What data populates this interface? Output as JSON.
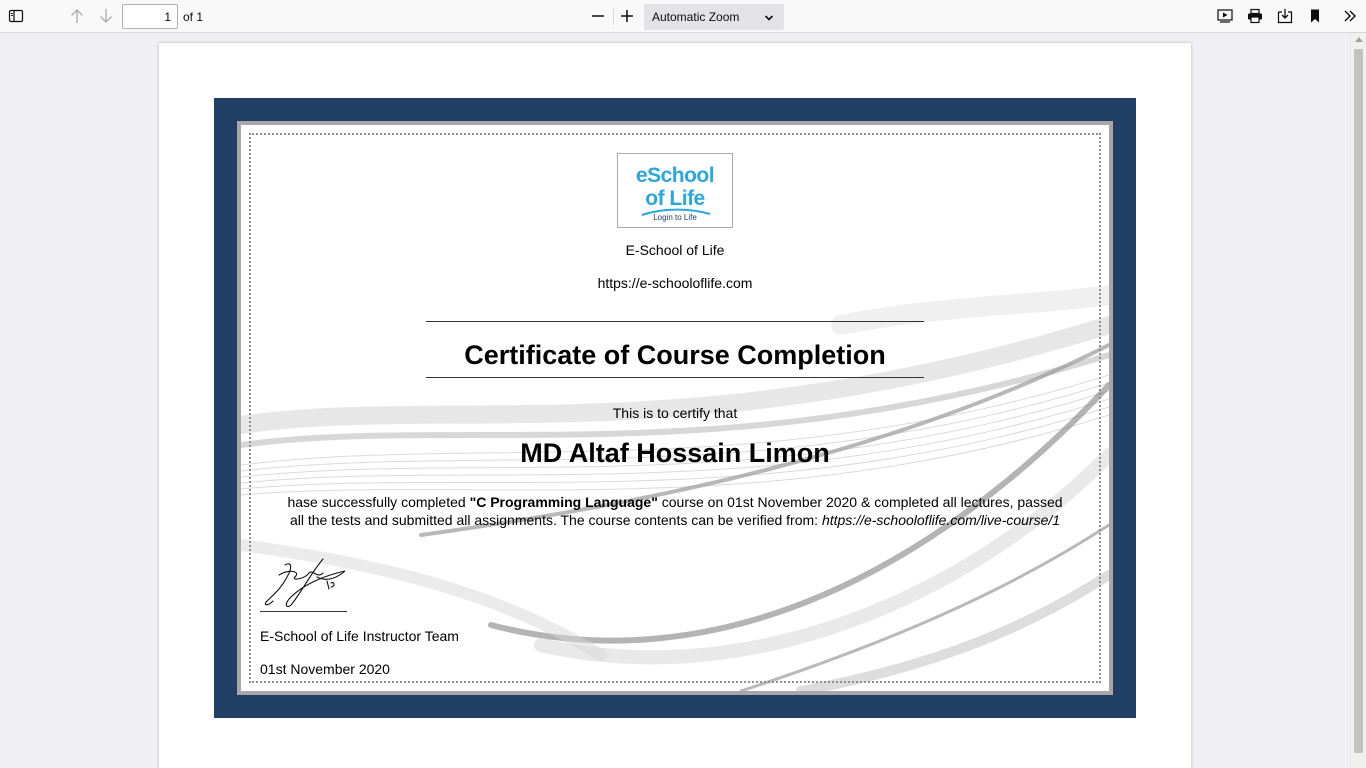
{
  "toolbar": {
    "icons": [
      "sidebar-toggle-icon",
      "arrow-up-icon",
      "arrow-down-icon",
      "minus-icon",
      "plus-icon",
      "chevron-down-icon",
      "presentation-icon",
      "print-icon",
      "save-icon",
      "bookmark-icon",
      "double-chevron-icon"
    ],
    "page_number": "1",
    "page_of": "of 1",
    "zoom_label": "Automatic Zoom"
  },
  "certificate": {
    "logo": {
      "line1": "eSchool",
      "line2": "of Life",
      "tagline": "Login to Life",
      "colors": {
        "primary": "#2aa7df",
        "secondary": "#1d3d6a"
      }
    },
    "school_name": "E-School of Life",
    "school_url": "https://e-schooloflife.com",
    "title": "Certificate of Course Completion",
    "certify_text": "This is to certify that",
    "recipient": "MD Altaf Hossain Limon",
    "body_prefix": "hase successfully completed ",
    "course": "\"C Programming Language\"",
    "body_line1_suffix": " course on 01st November 2020 & completed all lectures, passed",
    "body_line2": "all the tests and submitted all assignments. The course contents can be verified from: ",
    "verify_url": "https://e-schooloflife.com/live-course/1",
    "signer": "E-School of Life Instructor Team",
    "date": "01st November 2020",
    "frame_colors": {
      "outer": "#213f66",
      "middle": "#a7a7a7"
    }
  }
}
